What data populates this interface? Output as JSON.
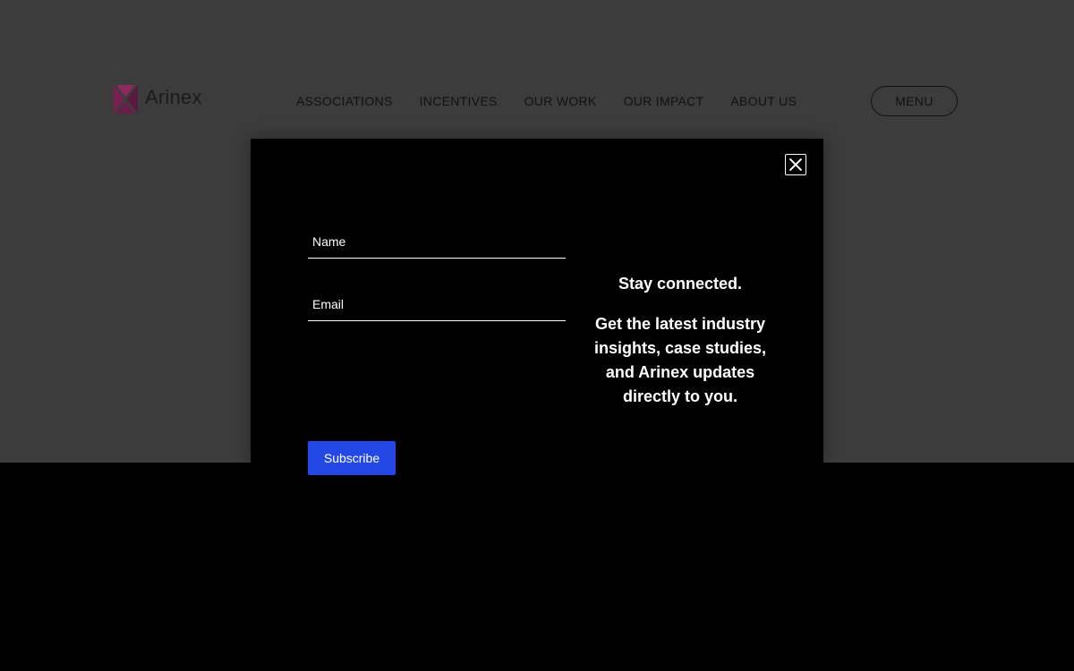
{
  "header": {
    "logo_text": "Arinex",
    "nav": [
      {
        "label": "ASSOCIATIONS"
      },
      {
        "label": "INCENTIVES"
      },
      {
        "label": "OUR WORK"
      },
      {
        "label": "OUR IMPACT"
      },
      {
        "label": "ABOUT US"
      }
    ],
    "menu_label": "MENU"
  },
  "modal": {
    "name_placeholder": "Name",
    "email_placeholder": "Email",
    "subscribe_label": "Subscribe",
    "heading": "Stay connected.",
    "body": "Get the latest industry insights, case studies, and Arinex updates directly to you."
  },
  "icons": {
    "logo": "arinex-x-logo-icon",
    "close": "close-icon"
  },
  "colors": {
    "page_dim": "#3c3c3c",
    "modal_bg": "#000000",
    "accent": "#2348e6",
    "logo_mark": "#7a1f52"
  }
}
